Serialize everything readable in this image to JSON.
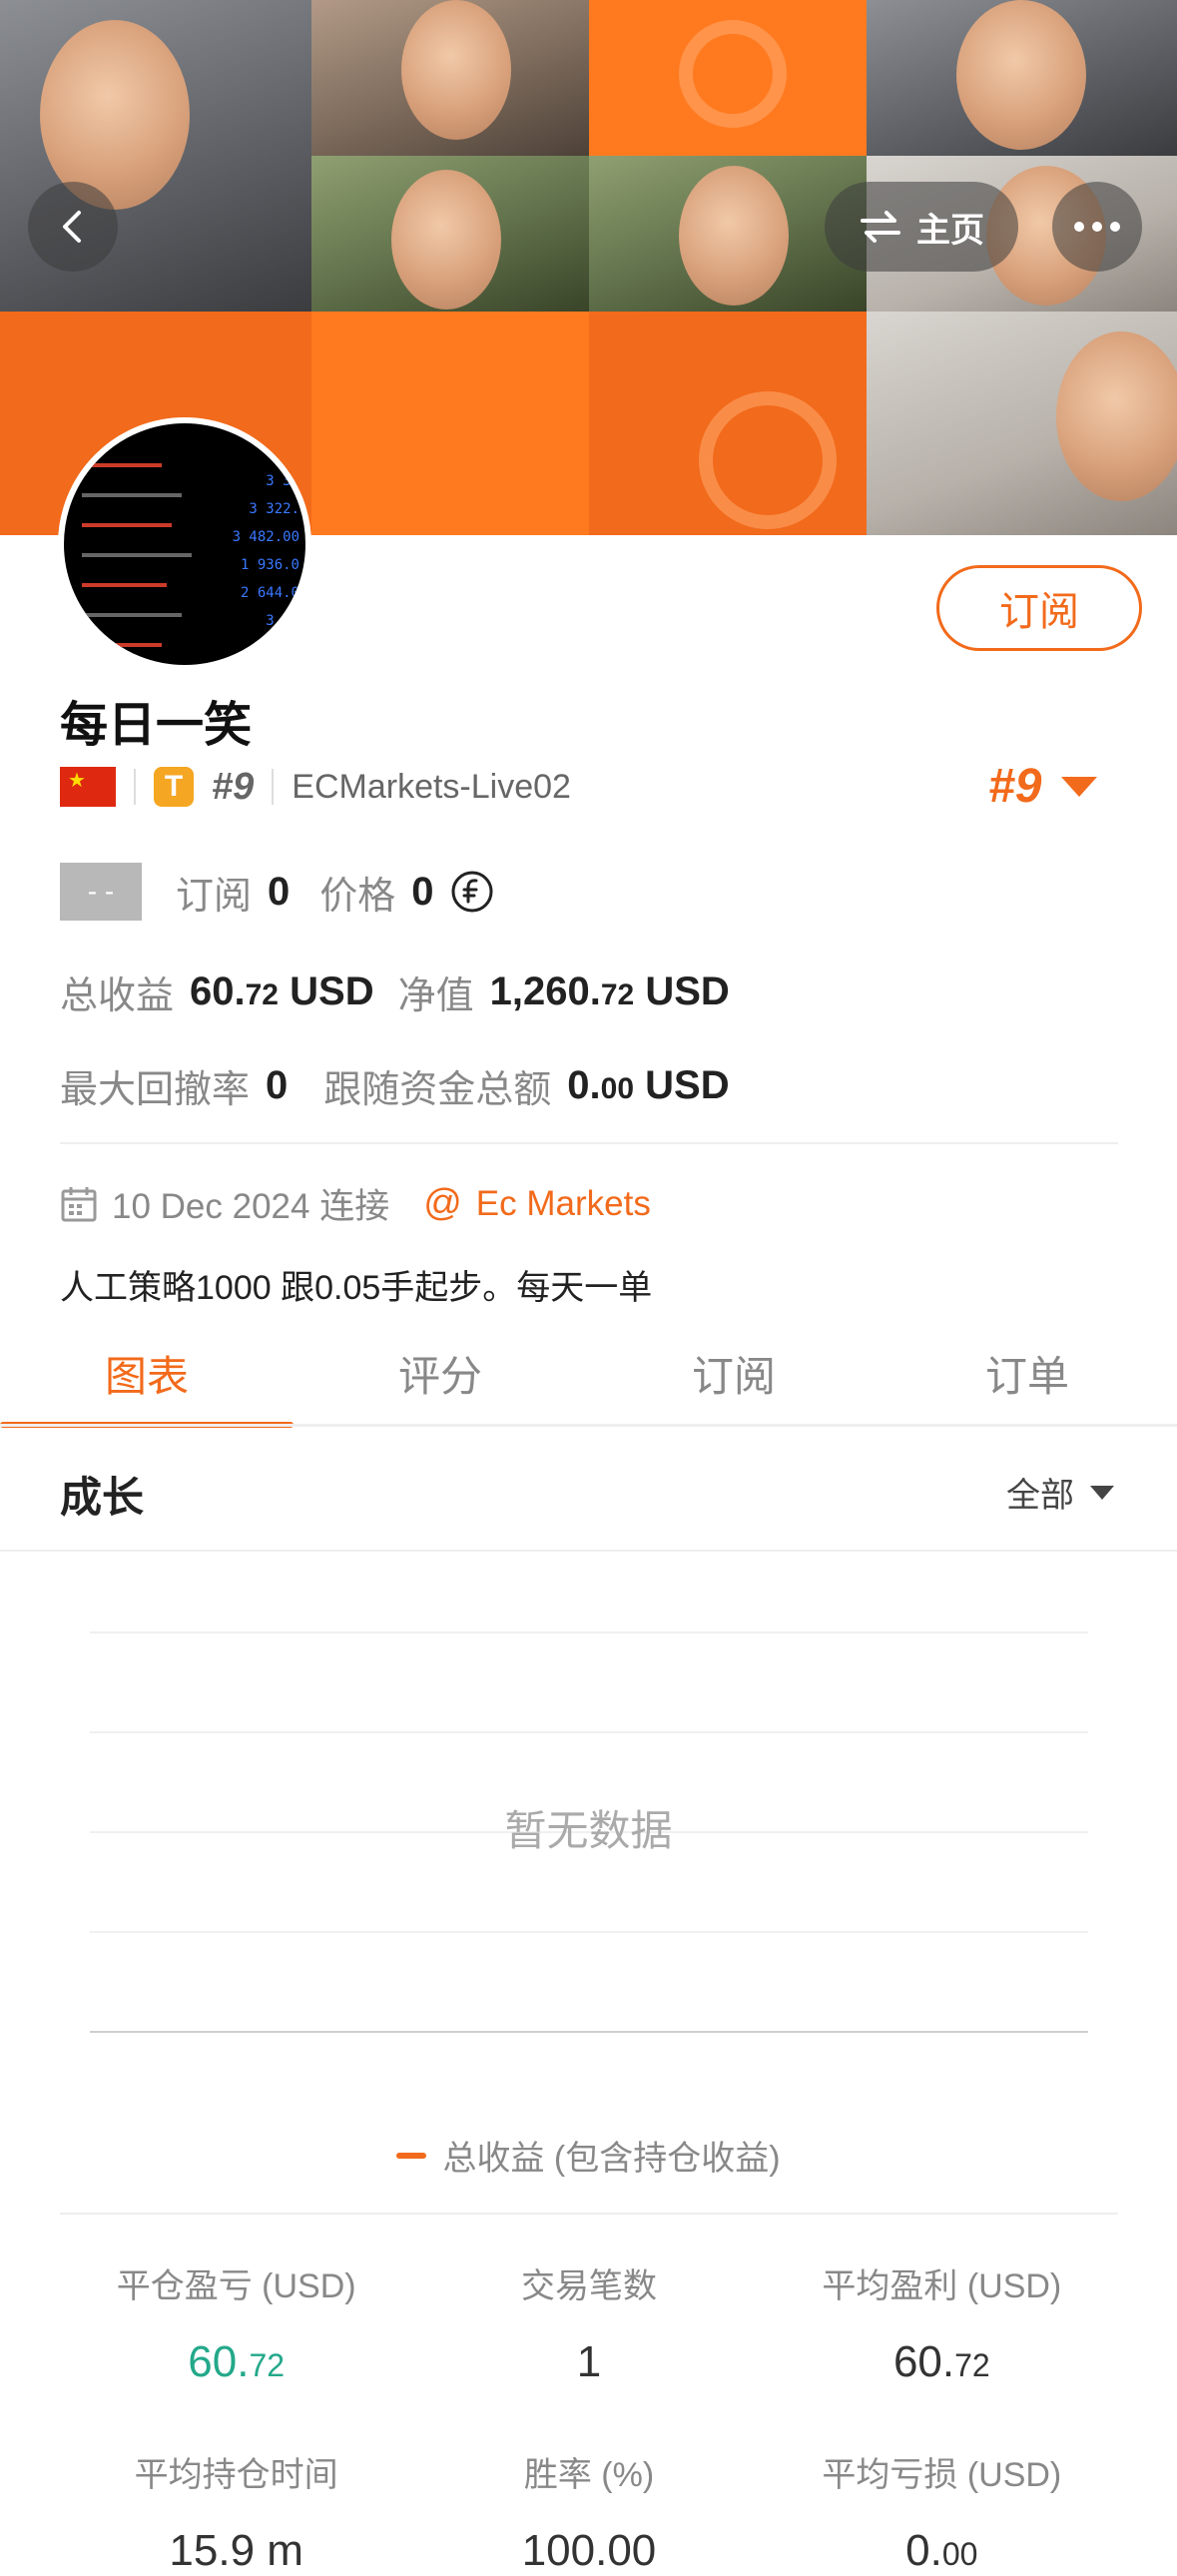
{
  "header": {
    "home_label": "主页"
  },
  "profile": {
    "subscribe_label": "订阅",
    "name": "每日一笑",
    "rank_hash": "#9",
    "server": "ECMarkets-Live02",
    "rank_right": "#9",
    "badge_letter": "T",
    "placeholder_badge": "- -",
    "subscribe_count_label": "订阅",
    "subscribe_count": "0",
    "price_label": "价格",
    "price": "0",
    "total_profit_label": "总收益",
    "total_profit_int": "60.",
    "total_profit_dec": "72",
    "total_profit_unit": "USD",
    "equity_label": "净值",
    "equity_int": "1,260.",
    "equity_dec": "72",
    "equity_unit": "USD",
    "max_drawdown_label": "最大回撤率",
    "max_drawdown": "0",
    "follow_funds_label": "跟随资金总额",
    "follow_funds_int": "0.",
    "follow_funds_dec": "00",
    "follow_funds_unit": "USD",
    "connected_date": "10 Dec 2024 连接",
    "broker": "Ec Markets",
    "description": "人工策略1000 跟0.05手起步。每天一单"
  },
  "tabs": [
    {
      "label": "图表"
    },
    {
      "label": "评分"
    },
    {
      "label": "订阅"
    },
    {
      "label": "订单"
    }
  ],
  "growth": {
    "title": "成长",
    "filter": "全部",
    "empty": "暂无数据",
    "legend": "总收益 (包含持仓收益)"
  },
  "metrics": [
    {
      "label": "平仓盈亏 (USD)",
      "int": "60.",
      "dec": "72"
    },
    {
      "label": "交易笔数",
      "int": "1",
      "dec": ""
    },
    {
      "label": "平均盈利 (USD)",
      "int": "60.",
      "dec": "72"
    },
    {
      "label": "平均持仓时间",
      "int": "15.9 m",
      "dec": ""
    },
    {
      "label": "胜率 (%)",
      "int": "100.00",
      "dec": ""
    },
    {
      "label": "平均亏损 (USD)",
      "int": "0.",
      "dec": "00"
    }
  ],
  "colors": {
    "accent": "#f26a1b",
    "profit_green": "#23a88a"
  },
  "icons": {
    "back": "chevron-left-icon",
    "switch": "swap-arrows-icon",
    "more": "more-dots-icon",
    "calendar": "calendar-icon",
    "at": "at-icon",
    "coin": "coin-icon"
  }
}
